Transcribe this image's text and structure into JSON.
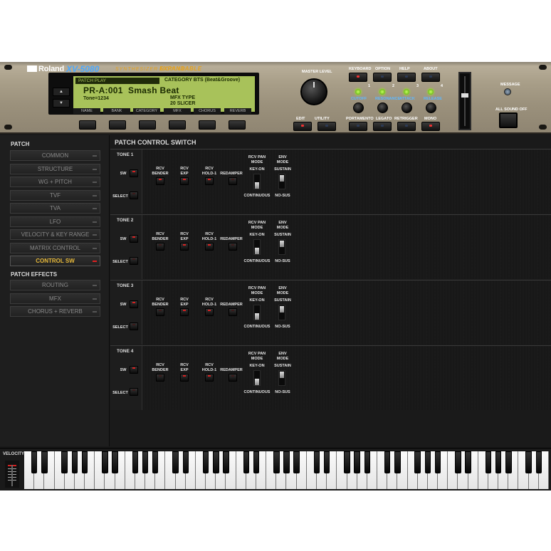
{
  "brand": {
    "maker": "Roland",
    "model": "XV-5080",
    "subtitle": "SYNTHESIZER MODULE",
    "subtitle2": "EXPANDABLE"
  },
  "lcd": {
    "mode": "PATCH PLAY",
    "category": "CATEGORY BTS (Beat&Groove)",
    "patch": "PR-A:001  Smash Beat",
    "tone": "Tone=1234",
    "mfx_label": "MFX TYPE",
    "mfx_value": "20 SLICER",
    "function_labels": [
      "NAME",
      "BANK",
      "CATEGORY",
      "MFX",
      "CHORUS",
      "REVERB"
    ]
  },
  "panel": {
    "master_level": "MASTER LEVEL",
    "top_buttons": [
      "KEYBOARD",
      "OPTION",
      "HELP",
      "ABOUT"
    ],
    "bottom_buttons": [
      "EDIT",
      "UTILITY",
      "PORTAMENTO",
      "LEGATO",
      "RETRIGGER",
      "MONO"
    ],
    "tone_numbers": [
      "1",
      "2",
      "3",
      "4"
    ],
    "knob_labels": [
      "CUTOFF",
      "RESONANCE",
      "ATTACK",
      "RELEASE"
    ],
    "message": "MESSAGE",
    "all_sound_off": "ALL SOUND OFF"
  },
  "sidebar": {
    "patch_title": "PATCH",
    "patch_items": [
      {
        "label": "COMMON",
        "active": false
      },
      {
        "label": "STRUCTURE",
        "active": false
      },
      {
        "label": "WG + PITCH",
        "active": false
      },
      {
        "label": "TVF",
        "active": false
      },
      {
        "label": "TVA",
        "active": false
      },
      {
        "label": "LFO",
        "active": false
      },
      {
        "label": "VELOCITY & KEY RANGE",
        "active": false
      },
      {
        "label": "MATRIX CONTROL",
        "active": false
      },
      {
        "label": "CONTROL SW",
        "active": true
      }
    ],
    "effects_title": "PATCH EFFECTS",
    "effects_items": [
      {
        "label": "ROUTING"
      },
      {
        "label": "MFX"
      },
      {
        "label": "CHORUS + REVERB"
      }
    ]
  },
  "main": {
    "title": "PATCH CONTROL SWITCH",
    "labels": {
      "sw": "SW",
      "select": "SELECT",
      "rcv_bender": "RCV\nBENDER",
      "rcv_exp": "RCV\nEXP",
      "rcv_hold": "RCV\nHOLD-1",
      "redamper": "REDAMPER",
      "pan_mode": "RCV PAN\nMODE",
      "key_on": "KEY-ON",
      "continuous": "CONTINUOUS",
      "env_mode": "ENV\nMODE",
      "sustain": "SUSTAIN",
      "no_sus": "NO-SUS"
    },
    "tones": [
      {
        "name": "TONE 1",
        "sw": true,
        "bender": true,
        "exp": true,
        "hold": true,
        "redamper": false
      },
      {
        "name": "TONE 2",
        "sw": true,
        "bender": false,
        "exp": true,
        "hold": true,
        "redamper": false
      },
      {
        "name": "TONE 3",
        "sw": true,
        "bender": false,
        "exp": true,
        "hold": true,
        "redamper": false
      },
      {
        "name": "TONE 4",
        "sw": true,
        "bender": false,
        "exp": true,
        "hold": true,
        "redamper": false
      }
    ]
  },
  "keyboard": {
    "velocity_label": "VELOCITY",
    "white_keys": 52
  }
}
